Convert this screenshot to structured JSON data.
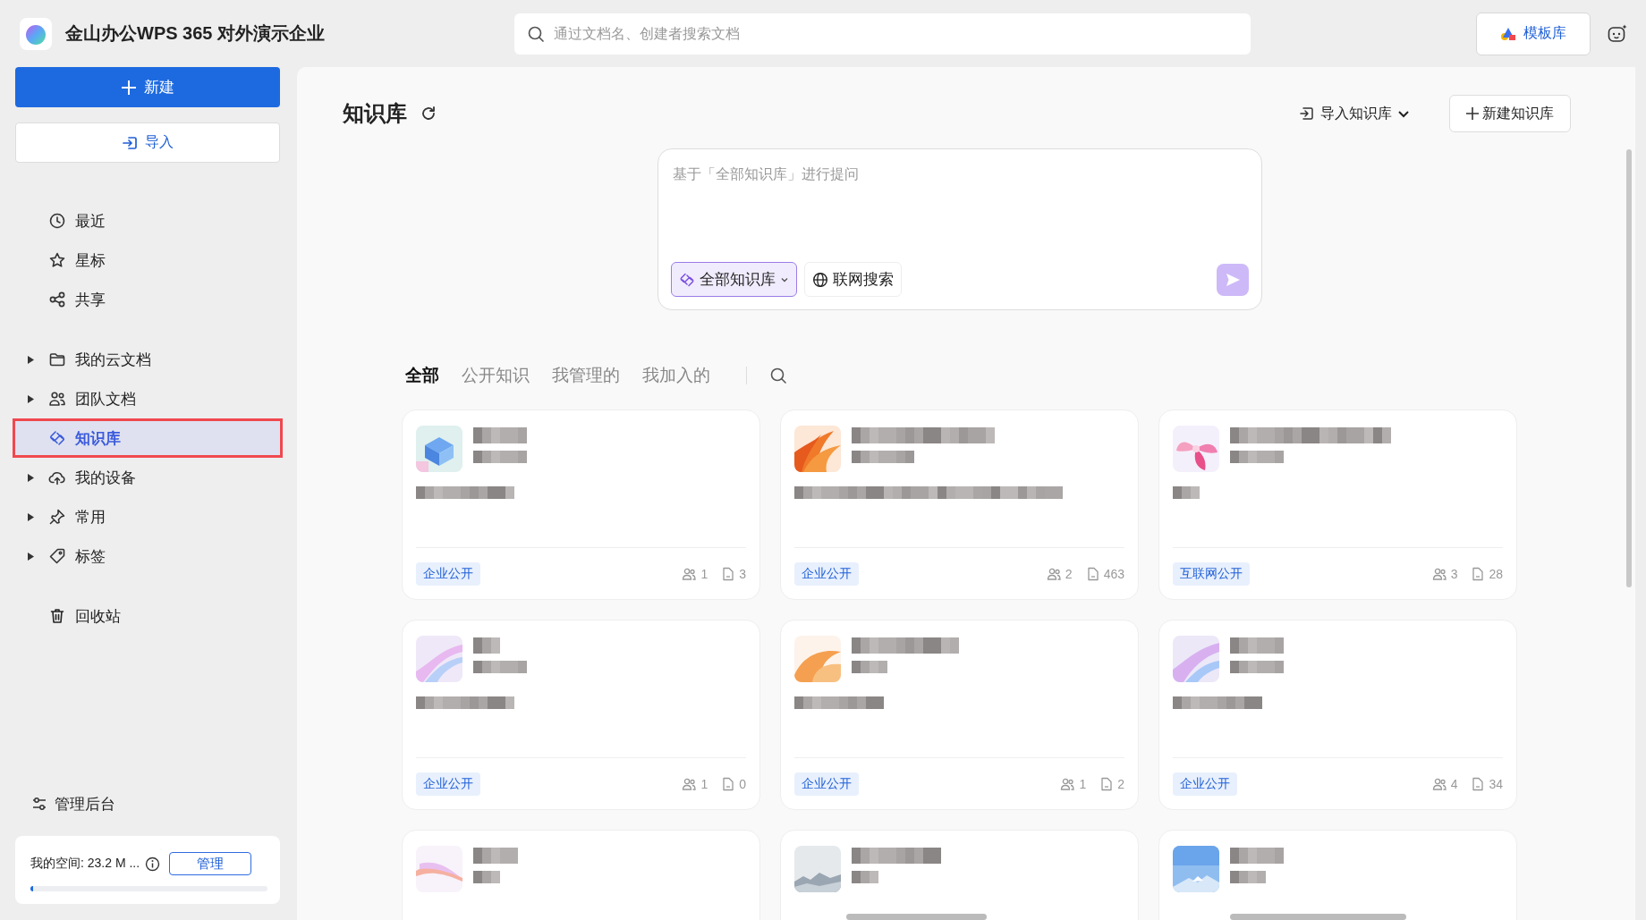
{
  "app": {
    "title": "金山办公WPS 365 对外演示企业"
  },
  "search": {
    "placeholder": "通过文档名、创建者搜索文档"
  },
  "header_buttons": {
    "templates": "模板库"
  },
  "sidebar": {
    "new_button": "新建",
    "import_button": "导入",
    "quick": [
      {
        "label": "最近",
        "selected": false
      },
      {
        "label": "星标",
        "selected": false
      },
      {
        "label": "共享",
        "selected": false
      }
    ],
    "tree": [
      {
        "label": "我的云文档",
        "expandable": true,
        "selected": false
      },
      {
        "label": "团队文档",
        "expandable": true,
        "selected": false
      },
      {
        "label": "知识库",
        "expandable": false,
        "selected": true
      },
      {
        "label": "我的设备",
        "expandable": true,
        "selected": false
      },
      {
        "label": "常用",
        "expandable": true,
        "selected": false
      },
      {
        "label": "标签",
        "expandable": true,
        "selected": false
      }
    ],
    "trash": "回收站",
    "admin": "管理后台",
    "storage": {
      "label": "我的空间: 23.2 M ...",
      "button": "管理",
      "level": 0.01
    }
  },
  "main": {
    "title": "知识库",
    "import_menu": "导入知识库",
    "new_button": "新建知识库",
    "ask": {
      "placeholder": "基于「全部知识库」进行提问",
      "scope": "全部知识库",
      "web_search": "联网搜索"
    },
    "tabs": [
      {
        "label": "全部",
        "selected": true
      },
      {
        "label": "公开知识",
        "selected": false
      },
      {
        "label": "我管理的",
        "selected": false
      },
      {
        "label": "我加入的",
        "selected": false
      }
    ],
    "cards": [
      {
        "kind": "full",
        "tag": "企业公开",
        "members": "1",
        "docs": "3"
      },
      {
        "kind": "full",
        "tag": "企业公开",
        "members": "2",
        "docs": "463"
      },
      {
        "kind": "full",
        "tag": "互联网公开",
        "members": "3",
        "docs": "28"
      },
      {
        "kind": "full",
        "tag": "企业公开",
        "members": "1",
        "docs": "0"
      },
      {
        "kind": "full",
        "tag": "企业公开",
        "members": "1",
        "docs": "2"
      },
      {
        "kind": "full",
        "tag": "企业公开",
        "members": "4",
        "docs": "34"
      },
      {
        "kind": "partial"
      },
      {
        "kind": "partial"
      },
      {
        "kind": "partial"
      }
    ]
  }
}
